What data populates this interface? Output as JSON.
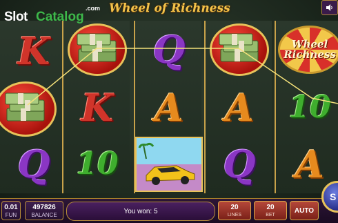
{
  "watermark": {
    "slot": "Slot",
    "catalog": "Catalog",
    "com": ".com"
  },
  "game": {
    "title": "Wheel of Richness"
  },
  "reels": [
    [
      "K",
      "money",
      "Q"
    ],
    [
      "money",
      "K",
      "10"
    ],
    [
      "Q",
      "A",
      "car"
    ],
    [
      "money",
      "A",
      "Q"
    ],
    [
      "wheel",
      "10",
      "A"
    ]
  ],
  "wheel_text": {
    "line1": "Wheel",
    "line2": "Richness"
  },
  "bottom": {
    "coin_value": "0.01",
    "coin_label": "FUN",
    "balance_value": "497826",
    "balance_label": "BALANCE",
    "win_text": "You won: 5",
    "lines_value": "20",
    "lines_label": "LINES",
    "bet_value": "20",
    "bet_label": "BET",
    "auto_label": "AUTO",
    "spin_label": "S"
  },
  "colors": {
    "accent_gold": "#e7c25a",
    "panel_purple": "#3e1f4e",
    "button_red": "#b5483a",
    "spin_blue": "#2a2f8a"
  },
  "icons": {
    "sound": "speaker-icon",
    "money": "money-stack-icon",
    "car": "sports-car-icon",
    "wheel": "fortune-wheel-icon"
  }
}
